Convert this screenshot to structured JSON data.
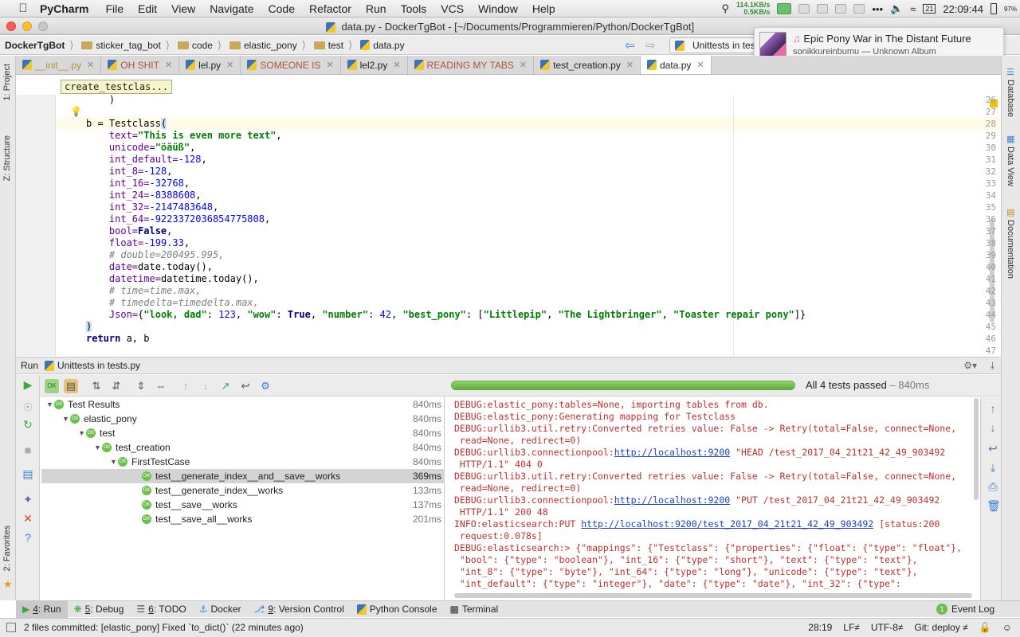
{
  "menubar": {
    "app": "PyCharm",
    "items": [
      "File",
      "Edit",
      "View",
      "Navigate",
      "Code",
      "Refactor",
      "Run",
      "Tools",
      "VCS",
      "Window",
      "Help"
    ],
    "net_up": "114.1KB/s",
    "net_down": "0.5KB/s",
    "clock": "22:09:44",
    "battery": "97%"
  },
  "window": {
    "title": "data.py - DockerTgBot - [~/Documents/Programmieren/Python/DockerTgBot]"
  },
  "nav": {
    "crumbs": [
      "DockerTgBot",
      "sticker_tag_bot",
      "code",
      "elastic_pony",
      "test",
      "data.py"
    ],
    "run_config": "Unittests in tests"
  },
  "notification": {
    "title": "Epic Pony War in The Distant Future",
    "subtitle": "sonikkureinbumu — Unknown Album"
  },
  "tabs": [
    {
      "label": "__init__.py",
      "active": false
    },
    {
      "label": "OH SHIT",
      "active": false
    },
    {
      "label": "lel.py",
      "active": false
    },
    {
      "label": "SOMEONE IS",
      "active": false
    },
    {
      "label": "lel2.py",
      "active": false
    },
    {
      "label": "READING MY TABS",
      "active": false
    },
    {
      "label": "test_creation.py",
      "active": false
    },
    {
      "label": "data.py",
      "active": true
    }
  ],
  "side_tools": {
    "left": [
      "1: Project",
      "Z: Structure",
      "2: Favorites"
    ],
    "right": [
      "Database",
      "Data View",
      "Documentation"
    ]
  },
  "editor": {
    "crumb": "create_testclas...",
    "line_numbers": [
      "26",
      "27",
      "28",
      "29",
      "30",
      "31",
      "32",
      "33",
      "34",
      "35",
      "36",
      "37",
      "38",
      "39",
      "40",
      "41",
      "42",
      "43",
      "44",
      "45",
      "46",
      "47"
    ],
    "lines": {
      "l26": "    )",
      "l28a": "b = Testclass",
      "l28b": "(",
      "p_text": "text=",
      "v_text": "\"This is even more text\"",
      "p_unicode": "unicode=",
      "v_unicode": "\"öäüß\"",
      "p_int_default": "int_default=",
      "v_int_default": "-128",
      "p_int_8": "int_8=",
      "v_int_8": "-128",
      "p_int_16": "int_16=",
      "v_int_16": "-32768",
      "p_int_24": "int_24=",
      "v_int_24": "-8388608",
      "p_int_32": "int_32=",
      "v_int_32": "-2147483648",
      "p_int_64": "int_64=",
      "v_int_64": "-9223372036854775808",
      "p_bool": "bool=",
      "v_bool": "False",
      "p_float": "float=",
      "v_float": "-199.33",
      "c_double": "# double=200495.995,",
      "p_date": "date=",
      "v_date": "date.today()",
      "p_datetime": "datetime=",
      "v_datetime": "datetime.today()",
      "c_time": "# time=time.max,",
      "c_timedelta": "# timedelta=timedelta.max,",
      "p_json": "Json=",
      "json_open": "{",
      "j_look": "\"look, dad\"",
      "j_123": "123",
      "j_wow": "\"wow\"",
      "j_true": "True",
      "j_number": "\"number\"",
      "j_42": "42",
      "j_best": "\"best_pony\"",
      "j_l1": "\"Littlepip\"",
      "j_l2": "\"The Lightbringer\"",
      "j_l3": "\"Toaster repair pony\"",
      "json_close": "]}",
      "l45": ")",
      "l46_kw": "return",
      "l46_rest": " a, b"
    }
  },
  "run": {
    "header": "Run",
    "config": "Unittests in tests.py",
    "progress": 1.0,
    "summary": "All 4 tests passed",
    "summary_duration": " – 840ms",
    "tree": [
      {
        "label": "Test Results",
        "duration": "840ms",
        "depth": 0,
        "selected": false
      },
      {
        "label": "elastic_pony",
        "duration": "840ms",
        "depth": 1,
        "selected": false
      },
      {
        "label": "test",
        "duration": "840ms",
        "depth": 2,
        "selected": false
      },
      {
        "label": "test_creation",
        "duration": "840ms",
        "depth": 3,
        "selected": false
      },
      {
        "label": "FirstTestCase",
        "duration": "840ms",
        "depth": 4,
        "selected": false
      },
      {
        "label": "test__generate_index__and__save__works",
        "duration": "369ms",
        "depth": 5,
        "selected": true
      },
      {
        "label": "test__generate_index__works",
        "duration": "133ms",
        "depth": 5,
        "selected": false
      },
      {
        "label": "test__save__works",
        "duration": "137ms",
        "depth": 5,
        "selected": false
      },
      {
        "label": "test__save_all__works",
        "duration": "201ms",
        "depth": 5,
        "selected": false
      }
    ],
    "console": {
      "c1": "DEBUG:elastic_pony:tables=None, importing tables from db.",
      "c2": "DEBUG:elastic_pony:Generating mapping for Testclass",
      "c3": "DEBUG:urllib3.util.retry:Converted retries value: False -> Retry(total=False, connect=None,",
      "c4": " read=None, redirect=0)",
      "c5a": "DEBUG:urllib3.connectionpool:",
      "c5link": "http://localhost:9200",
      "c5b": " \"HEAD /test_2017_04_21t21_42_49_903492",
      "c6": " HTTP/1.1\" 404 0",
      "c7": "DEBUG:urllib3.util.retry:Converted retries value: False -> Retry(total=False, connect=None,",
      "c8": " read=None, redirect=0)",
      "c9a": "DEBUG:urllib3.connectionpool:",
      "c9link": "http://localhost:9200",
      "c9b": " \"PUT /test_2017_04_21t21_42_49_903492",
      "c10": " HTTP/1.1\" 200 48",
      "c11a": "INFO:elasticsearch:PUT ",
      "c11link": "http://localhost:9200/test_2017_04_21t21_42_49_903492",
      "c11b": " [status:200",
      "c12": " request:0.078s]",
      "c13": "DEBUG:elasticsearch:> {\"mappings\": {\"Testclass\": {\"properties\": {\"float\": {\"type\": \"float\"},",
      "c14": " \"bool\": {\"type\": \"boolean\"}, \"int_16\": {\"type\": \"short\"}, \"text\": {\"type\": \"text\"},",
      "c15": " \"int_8\": {\"type\": \"byte\"}, \"int_64\": {\"type\": \"long\"}, \"unicode\": {\"type\": \"text\"},",
      "c16": " \"int_default\": {\"type\": \"integer\"}, \"date\": {\"type\": \"date\"}, \"int_32\": {\"type\":"
    }
  },
  "tooltabs": [
    {
      "num": "4",
      "label": ": Run",
      "active": true
    },
    {
      "num": "5",
      "label": ": Debug",
      "active": false
    },
    {
      "num": "6",
      "label": ": TODO",
      "active": false
    },
    {
      "num": "",
      "label": "Docker",
      "active": false
    },
    {
      "num": "9",
      "label": ": Version Control",
      "active": false
    },
    {
      "num": "",
      "label": "Python Console",
      "active": false
    },
    {
      "num": "",
      "label": "Terminal",
      "active": false
    }
  ],
  "event_log": {
    "count": "1",
    "label": "Event Log"
  },
  "status": {
    "message": "2 files committed: [elastic_pony] Fixed `to_dict()` (22 minutes ago)",
    "position": "28:19",
    "line_sep": "LF≠",
    "encoding": "UTF-8≠",
    "git": "Git: deploy ≠"
  },
  "colors": {
    "ok_green": "#6cbf4e",
    "console_red": "#c23030",
    "link_blue": "#1a3fd0"
  }
}
